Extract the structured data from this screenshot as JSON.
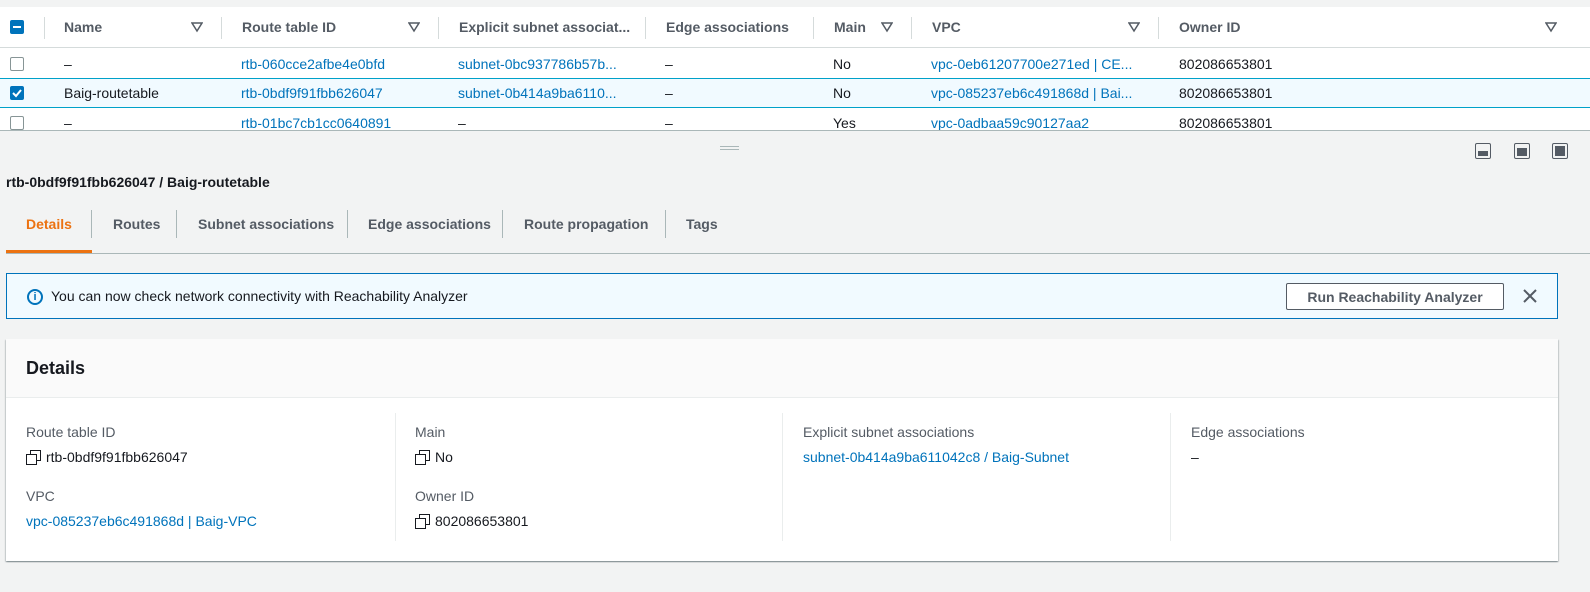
{
  "table": {
    "columns": [
      {
        "label": "Name"
      },
      {
        "label": "Route table ID"
      },
      {
        "label": "Explicit subnet associat..."
      },
      {
        "label": "Edge associations"
      },
      {
        "label": "Main"
      },
      {
        "label": "VPC"
      },
      {
        "label": "Owner ID"
      }
    ],
    "rows": [
      {
        "selected": false,
        "name": "–",
        "route_table_id": "rtb-060cce2afbe4e0bfd",
        "subnet": "subnet-0bc937786b57b...",
        "edge": "–",
        "main": "No",
        "vpc": "vpc-0eb61207700e271ed | CE...",
        "owner": "802086653801"
      },
      {
        "selected": true,
        "name": "Baig-routetable",
        "route_table_id": "rtb-0bdf9f91fbb626047",
        "subnet": "subnet-0b414a9ba6110...",
        "edge": "–",
        "main": "No",
        "vpc": "vpc-085237eb6c491868d | Bai...",
        "owner": "802086653801"
      },
      {
        "selected": false,
        "name": "–",
        "route_table_id": "rtb-01bc7cb1cc0640891",
        "subnet": "–",
        "edge": "–",
        "main": "Yes",
        "vpc": "vpc-0adbaa59c90127aa2",
        "owner": "802086653801"
      }
    ]
  },
  "detail": {
    "title": "rtb-0bdf9f91fbb626047 / Baig-routetable",
    "tabs": [
      {
        "label": "Details",
        "active": true
      },
      {
        "label": "Routes",
        "active": false
      },
      {
        "label": "Subnet associations",
        "active": false
      },
      {
        "label": "Edge associations",
        "active": false
      },
      {
        "label": "Route propagation",
        "active": false
      },
      {
        "label": "Tags",
        "active": false
      }
    ]
  },
  "banner": {
    "message": "You can now check network connectivity with Reachability Analyzer",
    "button": "Run Reachability Analyzer",
    "info_icon": "ⓘ",
    "close_icon": "close-icon"
  },
  "details": {
    "heading": "Details",
    "route_table_id_label": "Route table ID",
    "route_table_id_value": "rtb-0bdf9f91fbb626047",
    "vpc_label": "VPC",
    "vpc_value": "vpc-085237eb6c491868d | Baig-VPC",
    "main_label": "Main",
    "main_value": "No",
    "owner_label": "Owner ID",
    "owner_value": "802086653801",
    "subnet_label": "Explicit subnet associations",
    "subnet_value": "subnet-0b414a9ba611042c8 / Baig-Subnet",
    "edge_label": "Edge associations",
    "edge_value": "–"
  },
  "colors": {
    "accent": "#ec7211",
    "link": "#0073bb",
    "selected_row": "#f1faff"
  }
}
